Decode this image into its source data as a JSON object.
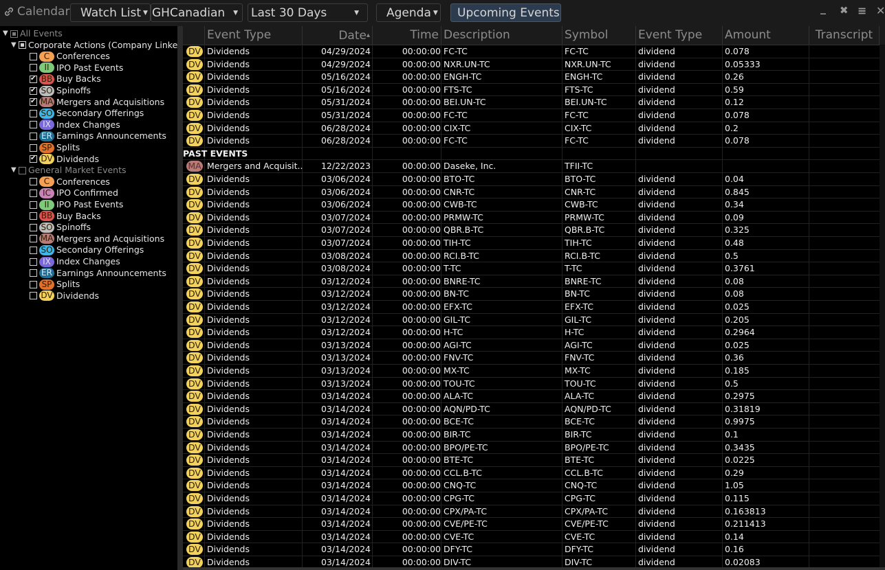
{
  "toolbar": {
    "title": "Calendar",
    "title_icon": "link-icon",
    "watchlist_label": "Watch List",
    "watchlist_value": "GHCanadian",
    "range_value": "Last 30 Days",
    "view_label": "Agenda",
    "upcoming_label": "Upcoming Events",
    "window_controls": [
      "minimize-icon",
      "expand-icon",
      "menu-icon",
      "close-icon"
    ]
  },
  "colors": {
    "C": "#f4a055",
    "II": "#7fc97a",
    "BB": "#d9534f",
    "SO_spin": "#bdbdbd",
    "MA": "#b97b78",
    "SO_sec": "#3db5e6",
    "IX": "#7b68d8",
    "ER": "#1f6f93",
    "SP": "#e0702a",
    "DV": "#f2d25c",
    "IC": "#c782b6",
    "upcoming_bg": "#2c3b4e"
  },
  "sidebar": {
    "root": {
      "label": "All Events",
      "state": "partial"
    },
    "groups": [
      {
        "label": "Corporate Actions (Company Linked",
        "state": "partial",
        "items": [
          {
            "code": "C",
            "color": "#f4a055",
            "label": "Conferences",
            "checked": false
          },
          {
            "code": "II",
            "color": "#7fc97a",
            "label": "IPO Past Events",
            "checked": false
          },
          {
            "code": "BB",
            "color": "#d9534f",
            "label": "Buy Backs",
            "checked": true
          },
          {
            "code": "SO",
            "color": "#bdbdbd",
            "label": "Spinoffs",
            "checked": true
          },
          {
            "code": "MA",
            "color": "#b97b78",
            "label": "Mergers and Acquisitions",
            "checked": true
          },
          {
            "code": "SO",
            "color": "#3db5e6",
            "label": "Secondary Offerings",
            "checked": false
          },
          {
            "code": "IX",
            "color": "#7b68d8",
            "label": "Index Changes",
            "checked": false
          },
          {
            "code": "ER",
            "color": "#1f6f93",
            "label": "Earnings Announcements",
            "checked": false
          },
          {
            "code": "SP",
            "color": "#e0702a",
            "label": "Splits",
            "checked": false
          },
          {
            "code": "DV",
            "color": "#f2d25c",
            "label": "Dividends",
            "checked": true
          }
        ]
      },
      {
        "label": "General Market Events",
        "state": "unchecked",
        "items": [
          {
            "code": "C",
            "color": "#f4a055",
            "label": "Conferences",
            "checked": false
          },
          {
            "code": "IC",
            "color": "#c782b6",
            "label": "IPO Confirmed",
            "checked": false
          },
          {
            "code": "II",
            "color": "#7fc97a",
            "label": "IPO Past Events",
            "checked": false
          },
          {
            "code": "BB",
            "color": "#d9534f",
            "label": "Buy Backs",
            "checked": false
          },
          {
            "code": "SO",
            "color": "#bdbdbd",
            "label": "Spinoffs",
            "checked": false
          },
          {
            "code": "MA",
            "color": "#b97b78",
            "label": "Mergers and Acquisitions",
            "checked": false
          },
          {
            "code": "SO",
            "color": "#3db5e6",
            "label": "Secondary Offerings",
            "checked": false
          },
          {
            "code": "IX",
            "color": "#7b68d8",
            "label": "Index Changes",
            "checked": false
          },
          {
            "code": "ER",
            "color": "#1f6f93",
            "label": "Earnings Announcements",
            "checked": false
          },
          {
            "code": "SP",
            "color": "#e0702a",
            "label": "Splits",
            "checked": false
          },
          {
            "code": "DV",
            "color": "#f2d25c",
            "label": "Dividends",
            "checked": false
          }
        ]
      }
    ]
  },
  "grid": {
    "columns": [
      "",
      "Event Type",
      "Date",
      "Time",
      "Description",
      "Symbol",
      "Event Type",
      "Amount",
      "Transcript"
    ],
    "sort_column": "Date",
    "sort_dir": "asc",
    "rows": [
      {
        "code": "DV",
        "type": "Dividends",
        "date": "04/29/2024",
        "time": "00:00:00",
        "desc": "FC-TC",
        "symbol": "FC-TC",
        "etype": "dividend",
        "amount": "0.078"
      },
      {
        "code": "DV",
        "type": "Dividends",
        "date": "04/29/2024",
        "time": "00:00:00",
        "desc": "NXR.UN-TC",
        "symbol": "NXR.UN-TC",
        "etype": "dividend",
        "amount": "0.05333"
      },
      {
        "code": "DV",
        "type": "Dividends",
        "date": "05/16/2024",
        "time": "00:00:00",
        "desc": "ENGH-TC",
        "symbol": "ENGH-TC",
        "etype": "dividend",
        "amount": "0.26"
      },
      {
        "code": "DV",
        "type": "Dividends",
        "date": "05/16/2024",
        "time": "00:00:00",
        "desc": "FTS-TC",
        "symbol": "FTS-TC",
        "etype": "dividend",
        "amount": "0.59"
      },
      {
        "code": "DV",
        "type": "Dividends",
        "date": "05/31/2024",
        "time": "00:00:00",
        "desc": "BEI.UN-TC",
        "symbol": "BEI.UN-TC",
        "etype": "dividend",
        "amount": "0.12"
      },
      {
        "code": "DV",
        "type": "Dividends",
        "date": "05/31/2024",
        "time": "00:00:00",
        "desc": "FC-TC",
        "symbol": "FC-TC",
        "etype": "dividend",
        "amount": "0.078"
      },
      {
        "code": "DV",
        "type": "Dividends",
        "date": "06/28/2024",
        "time": "00:00:00",
        "desc": "CIX-TC",
        "symbol": "CIX-TC",
        "etype": "dividend",
        "amount": "0.2"
      },
      {
        "code": "DV",
        "type": "Dividends",
        "date": "06/28/2024",
        "time": "00:00:00",
        "desc": "FC-TC",
        "symbol": "FC-TC",
        "etype": "dividend",
        "amount": "0.078"
      },
      {
        "section": "PAST EVENTS"
      },
      {
        "code": "MA",
        "type": "Mergers and Acquisit...",
        "date": "12/22/2023",
        "time": "00:00:00",
        "desc": "Daseke, Inc.",
        "symbol": "TFII-TC",
        "etype": "",
        "amount": ""
      },
      {
        "code": "DV",
        "type": "Dividends",
        "date": "03/06/2024",
        "time": "00:00:00",
        "desc": "BTO-TC",
        "symbol": "BTO-TC",
        "etype": "dividend",
        "amount": "0.04"
      },
      {
        "code": "DV",
        "type": "Dividends",
        "date": "03/06/2024",
        "time": "00:00:00",
        "desc": "CNR-TC",
        "symbol": "CNR-TC",
        "etype": "dividend",
        "amount": "0.845"
      },
      {
        "code": "DV",
        "type": "Dividends",
        "date": "03/06/2024",
        "time": "00:00:00",
        "desc": "CWB-TC",
        "symbol": "CWB-TC",
        "etype": "dividend",
        "amount": "0.34"
      },
      {
        "code": "DV",
        "type": "Dividends",
        "date": "03/07/2024",
        "time": "00:00:00",
        "desc": "PRMW-TC",
        "symbol": "PRMW-TC",
        "etype": "dividend",
        "amount": "0.09"
      },
      {
        "code": "DV",
        "type": "Dividends",
        "date": "03/07/2024",
        "time": "00:00:00",
        "desc": "QBR.B-TC",
        "symbol": "QBR.B-TC",
        "etype": "dividend",
        "amount": "0.325"
      },
      {
        "code": "DV",
        "type": "Dividends",
        "date": "03/07/2024",
        "time": "00:00:00",
        "desc": "TIH-TC",
        "symbol": "TIH-TC",
        "etype": "dividend",
        "amount": "0.48"
      },
      {
        "code": "DV",
        "type": "Dividends",
        "date": "03/08/2024",
        "time": "00:00:00",
        "desc": "RCI.B-TC",
        "symbol": "RCI.B-TC",
        "etype": "dividend",
        "amount": "0.5"
      },
      {
        "code": "DV",
        "type": "Dividends",
        "date": "03/08/2024",
        "time": "00:00:00",
        "desc": "T-TC",
        "symbol": "T-TC",
        "etype": "dividend",
        "amount": "0.3761"
      },
      {
        "code": "DV",
        "type": "Dividends",
        "date": "03/12/2024",
        "time": "00:00:00",
        "desc": "BNRE-TC",
        "symbol": "BNRE-TC",
        "etype": "dividend",
        "amount": "0.08"
      },
      {
        "code": "DV",
        "type": "Dividends",
        "date": "03/12/2024",
        "time": "00:00:00",
        "desc": "BN-TC",
        "symbol": "BN-TC",
        "etype": "dividend",
        "amount": "0.08"
      },
      {
        "code": "DV",
        "type": "Dividends",
        "date": "03/12/2024",
        "time": "00:00:00",
        "desc": "EFX-TC",
        "symbol": "EFX-TC",
        "etype": "dividend",
        "amount": "0.025"
      },
      {
        "code": "DV",
        "type": "Dividends",
        "date": "03/12/2024",
        "time": "00:00:00",
        "desc": "GIL-TC",
        "symbol": "GIL-TC",
        "etype": "dividend",
        "amount": "0.205"
      },
      {
        "code": "DV",
        "type": "Dividends",
        "date": "03/12/2024",
        "time": "00:00:00",
        "desc": "H-TC",
        "symbol": "H-TC",
        "etype": "dividend",
        "amount": "0.2964"
      },
      {
        "code": "DV",
        "type": "Dividends",
        "date": "03/13/2024",
        "time": "00:00:00",
        "desc": "AGI-TC",
        "symbol": "AGI-TC",
        "etype": "dividend",
        "amount": "0.025"
      },
      {
        "code": "DV",
        "type": "Dividends",
        "date": "03/13/2024",
        "time": "00:00:00",
        "desc": "FNV-TC",
        "symbol": "FNV-TC",
        "etype": "dividend",
        "amount": "0.36"
      },
      {
        "code": "DV",
        "type": "Dividends",
        "date": "03/13/2024",
        "time": "00:00:00",
        "desc": "MX-TC",
        "symbol": "MX-TC",
        "etype": "dividend",
        "amount": "0.185"
      },
      {
        "code": "DV",
        "type": "Dividends",
        "date": "03/13/2024",
        "time": "00:00:00",
        "desc": "TOU-TC",
        "symbol": "TOU-TC",
        "etype": "dividend",
        "amount": "0.5"
      },
      {
        "code": "DV",
        "type": "Dividends",
        "date": "03/14/2024",
        "time": "00:00:00",
        "desc": "ALA-TC",
        "symbol": "ALA-TC",
        "etype": "dividend",
        "amount": "0.2975"
      },
      {
        "code": "DV",
        "type": "Dividends",
        "date": "03/14/2024",
        "time": "00:00:00",
        "desc": "AQN/PD-TC",
        "symbol": "AQN/PD-TC",
        "etype": "dividend",
        "amount": "0.31819"
      },
      {
        "code": "DV",
        "type": "Dividends",
        "date": "03/14/2024",
        "time": "00:00:00",
        "desc": "BCE-TC",
        "symbol": "BCE-TC",
        "etype": "dividend",
        "amount": "0.9975"
      },
      {
        "code": "DV",
        "type": "Dividends",
        "date": "03/14/2024",
        "time": "00:00:00",
        "desc": "BIR-TC",
        "symbol": "BIR-TC",
        "etype": "dividend",
        "amount": "0.1"
      },
      {
        "code": "DV",
        "type": "Dividends",
        "date": "03/14/2024",
        "time": "00:00:00",
        "desc": "BPO/PE-TC",
        "symbol": "BPO/PE-TC",
        "etype": "dividend",
        "amount": "0.3435"
      },
      {
        "code": "DV",
        "type": "Dividends",
        "date": "03/14/2024",
        "time": "00:00:00",
        "desc": "BTE-TC",
        "symbol": "BTE-TC",
        "etype": "dividend",
        "amount": "0.0225"
      },
      {
        "code": "DV",
        "type": "Dividends",
        "date": "03/14/2024",
        "time": "00:00:00",
        "desc": "CCL.B-TC",
        "symbol": "CCL.B-TC",
        "etype": "dividend",
        "amount": "0.29"
      },
      {
        "code": "DV",
        "type": "Dividends",
        "date": "03/14/2024",
        "time": "00:00:00",
        "desc": "CNQ-TC",
        "symbol": "CNQ-TC",
        "etype": "dividend",
        "amount": "1.05"
      },
      {
        "code": "DV",
        "type": "Dividends",
        "date": "03/14/2024",
        "time": "00:00:00",
        "desc": "CPG-TC",
        "symbol": "CPG-TC",
        "etype": "dividend",
        "amount": "0.115"
      },
      {
        "code": "DV",
        "type": "Dividends",
        "date": "03/14/2024",
        "time": "00:00:00",
        "desc": "CPX/PA-TC",
        "symbol": "CPX/PA-TC",
        "etype": "dividend",
        "amount": "0.163813"
      },
      {
        "code": "DV",
        "type": "Dividends",
        "date": "03/14/2024",
        "time": "00:00:00",
        "desc": "CVE/PE-TC",
        "symbol": "CVE/PE-TC",
        "etype": "dividend",
        "amount": "0.211413"
      },
      {
        "code": "DV",
        "type": "Dividends",
        "date": "03/14/2024",
        "time": "00:00:00",
        "desc": "CVE-TC",
        "symbol": "CVE-TC",
        "etype": "dividend",
        "amount": "0.14"
      },
      {
        "code": "DV",
        "type": "Dividends",
        "date": "03/14/2024",
        "time": "00:00:00",
        "desc": "DFY-TC",
        "symbol": "DFY-TC",
        "etype": "dividend",
        "amount": "0.16"
      },
      {
        "code": "DV",
        "type": "Dividends",
        "date": "03/14/2024",
        "time": "00:00:00",
        "desc": "DIV-TC",
        "symbol": "DIV-TC",
        "etype": "dividend",
        "amount": "0.02083"
      }
    ]
  }
}
